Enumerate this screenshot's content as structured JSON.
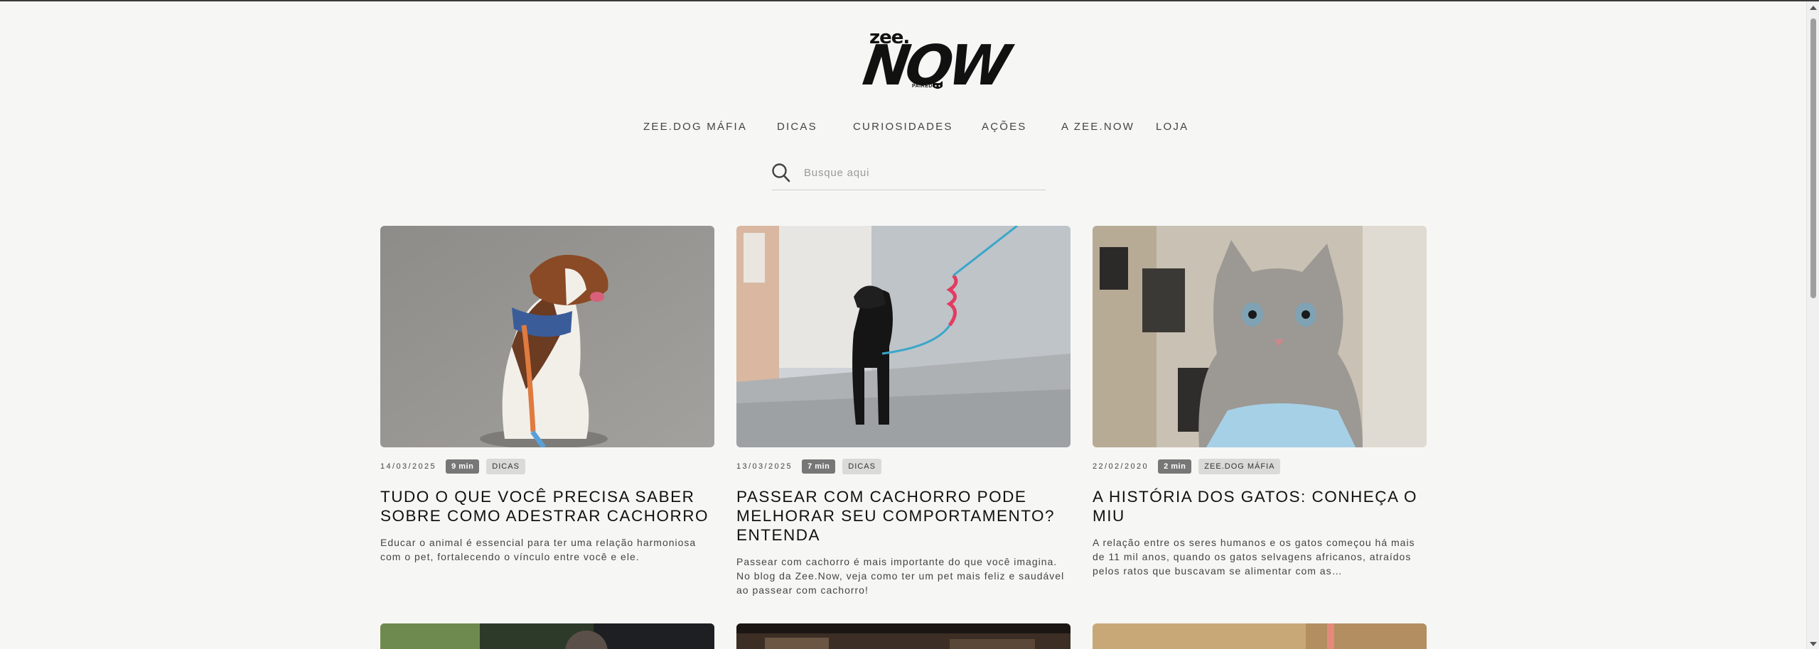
{
  "brand": {
    "logo_top": "zee.",
    "logo_main": "NOW",
    "logo_sub": "PAIRED BY"
  },
  "nav": {
    "items": [
      {
        "label": "ZEE.DOG MÁFIA"
      },
      {
        "label": "DICAS"
      },
      {
        "label": "CURIOSIDADES"
      },
      {
        "label": "AÇÕES"
      },
      {
        "label": "A ZEE.NOW"
      },
      {
        "label": "LOJA"
      }
    ]
  },
  "search": {
    "placeholder": "Busque aqui",
    "icon": "search-icon"
  },
  "posts": [
    {
      "date": "14/03/2025",
      "read_time": "9 min",
      "category": "DICAS",
      "title": "TUDO O QUE VOCÊ PRECISA SABER SOBRE COMO ADESTRAR CACHORRO",
      "excerpt": "Educar o animal é essencial para ter uma relação harmoniosa com o pet, fortalecendo o vínculo entre você e ele."
    },
    {
      "date": "13/03/2025",
      "read_time": "7 min",
      "category": "DICAS",
      "title": "PASSEAR COM CACHORRO PODE MELHORAR SEU COMPORTAMENTO? ENTENDA",
      "excerpt": "Passear com cachorro é mais importante do que você imagina. No blog da Zee.Now, veja como ter um pet mais feliz e saudável ao passear com cachorro!"
    },
    {
      "date": "22/02/2020",
      "read_time": "2 min",
      "category": "ZEE.DOG MÁFIA",
      "title": "A HISTÓRIA DOS GATOS: CONHEÇA O MIU",
      "excerpt": "A relação entre os seres humanos e os gatos começou há mais de 11 mil anos, quando os gatos selvagens africanos, atraídos pelos ratos que buscavam se alimentar com as…"
    }
  ],
  "colors": {
    "background": "#f6f6f4",
    "badge_time": "#777777",
    "badge_category": "#dadad8",
    "text": "#111111"
  }
}
